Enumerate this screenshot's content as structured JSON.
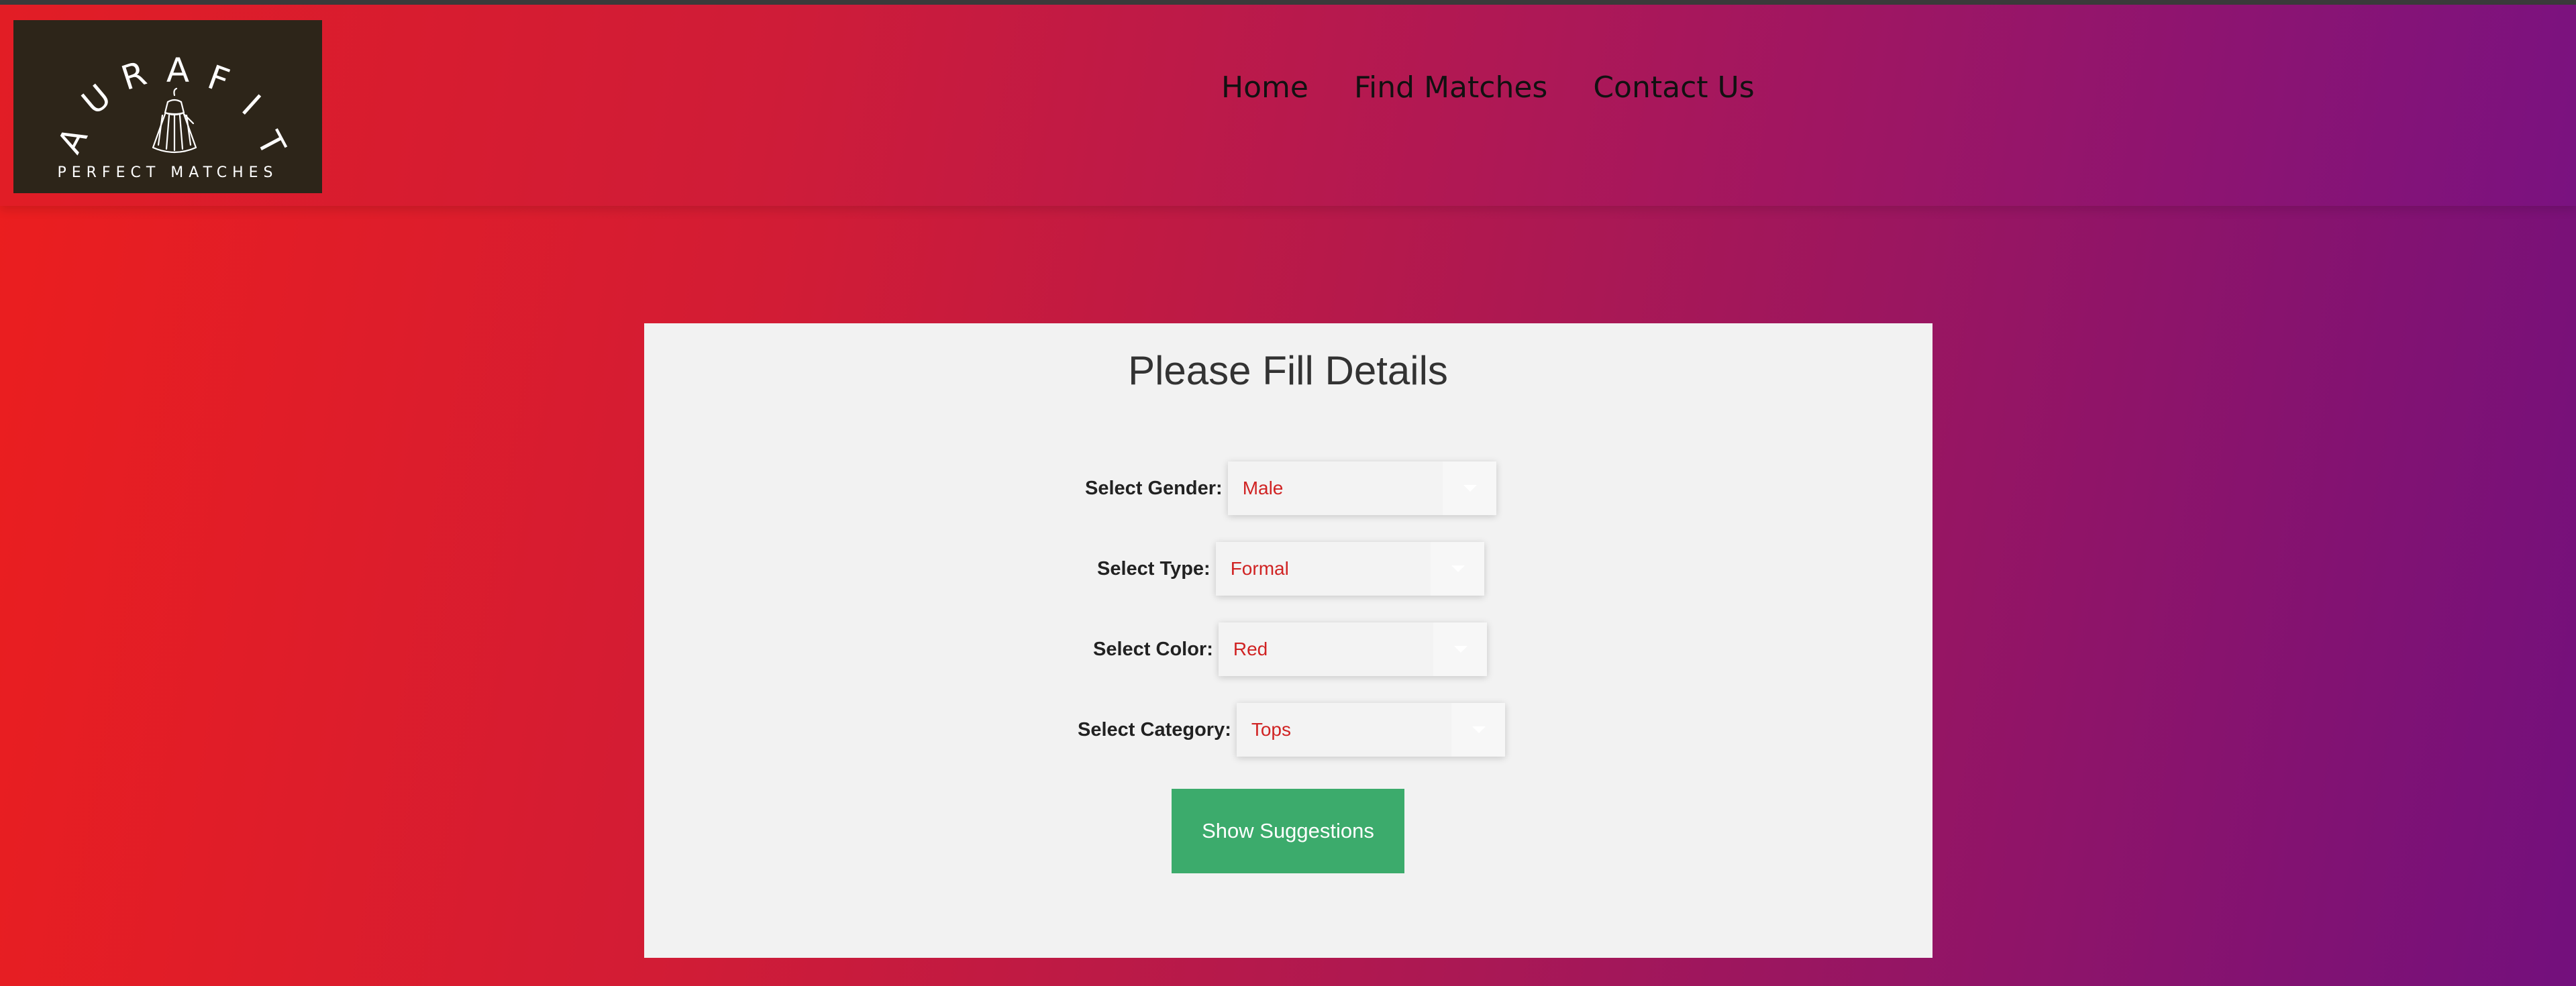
{
  "logo": {
    "brand_letters": [
      "A",
      "U",
      "R",
      "A",
      "F",
      "I",
      "T"
    ],
    "tagline": "PERFECT MATCHES"
  },
  "nav": {
    "items": [
      "Home",
      "Find Matches",
      "Contact Us"
    ]
  },
  "form": {
    "title": "Please Fill Details",
    "fields": [
      {
        "label": "Select Gender:",
        "value": "Male"
      },
      {
        "label": "Select Type:",
        "value": "Formal"
      },
      {
        "label": "Select Color:",
        "value": "Red"
      },
      {
        "label": "Select Category:",
        "value": "Tops"
      }
    ],
    "submit_label": "Show Suggestions"
  },
  "colors": {
    "select_text": "#d02323",
    "button": "#3cab6c",
    "logo_bg": "#2d2519"
  },
  "icons": [
    "dress-icon",
    "dropdown-arrow-icon"
  ]
}
